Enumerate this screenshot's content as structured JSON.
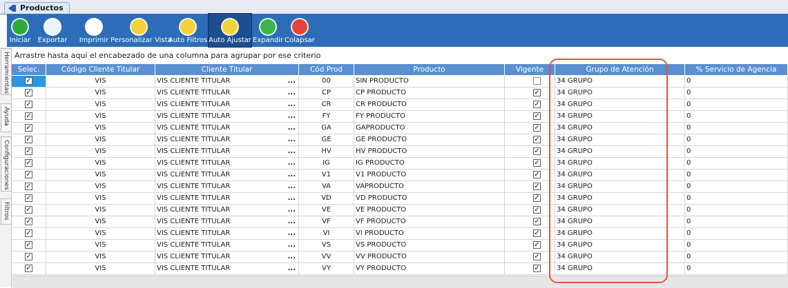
{
  "window_tab": {
    "label": "Productos"
  },
  "toolbar": [
    {
      "name": "iniciar-button",
      "label": "Iniciar",
      "icon": "play-icon",
      "color": "#2eaa3c"
    },
    {
      "name": "exportar-button",
      "label": "Exportar",
      "icon": "export-doc-icon",
      "color": "#e9f4ff"
    },
    {
      "name": "imprimir-button",
      "label": "Imprimir",
      "icon": "printer-icon",
      "color": "#ffffff"
    },
    {
      "name": "personalizar-vista-button",
      "label": "Personalizar Vista",
      "icon": "grid-view-icon",
      "color": "#f2d23a"
    },
    {
      "name": "auto-filtros-button",
      "label": "Auto Filtros",
      "icon": "filter-icon",
      "color": "#f2d23a"
    },
    {
      "name": "auto-ajustar-button",
      "label": "Auto Ajustar",
      "icon": "tools-icon",
      "color": "#f2d23a",
      "active": true
    },
    {
      "name": "expandir-button",
      "label": "Expandir",
      "icon": "expand-icon",
      "color": "#3ab54a"
    },
    {
      "name": "colapsar-button",
      "label": "Colapsar",
      "icon": "collapse-icon",
      "color": "#e2443a"
    }
  ],
  "side_tabs": [
    "Herramientas",
    "Ayuda",
    "Configuraciones",
    "Filtros"
  ],
  "group_hint": "Arrastre hasta aquí el encabezado de una columna para agrupar por ese criterio",
  "columns": [
    "Selec.",
    "Código Cliente Titular",
    "Cliente Titular",
    "Cód Prod",
    "Producto",
    "Vigente",
    "Grupo de Atención",
    "% Servicio de Agencia"
  ],
  "rows": [
    {
      "selected": true,
      "code": "VIS",
      "client": "VIS CLIENTE TITULAR",
      "prod_code": "00",
      "product": "SIN PRODUCTO",
      "vigente": false,
      "grupo": "34 GRUPO",
      "servicio": "0"
    },
    {
      "selected": true,
      "code": "VIS",
      "client": "VIS CLIENTE TITULAR",
      "prod_code": "CP",
      "product": "CP PRODUCTO",
      "vigente": true,
      "grupo": "34 GRUPO",
      "servicio": "0"
    },
    {
      "selected": true,
      "code": "VIS",
      "client": "VIS CLIENTE TITULAR",
      "prod_code": "CR",
      "product": "CR PRODUCTO",
      "vigente": true,
      "grupo": "34 GRUPO",
      "servicio": "0"
    },
    {
      "selected": true,
      "code": "VIS",
      "client": "VIS CLIENTE TITULAR",
      "prod_code": "FY",
      "product": "FY PRODUCTO",
      "vigente": true,
      "grupo": "34 GRUPO",
      "servicio": "0"
    },
    {
      "selected": true,
      "code": "VIS",
      "client": "VIS CLIENTE TITULAR",
      "prod_code": "GA",
      "product": "GAPRODUCTO",
      "vigente": true,
      "grupo": "34 GRUPO",
      "servicio": "0"
    },
    {
      "selected": true,
      "code": "VIS",
      "client": "VIS CLIENTE TITULAR",
      "prod_code": "GE",
      "product": "GE PRODUCTO",
      "vigente": true,
      "grupo": "34 GRUPO",
      "servicio": "0"
    },
    {
      "selected": true,
      "code": "VIS",
      "client": "VIS CLIENTE TITULAR",
      "prod_code": "HV",
      "product": "HV PRODUCTO",
      "vigente": true,
      "grupo": "34 GRUPO",
      "servicio": "0"
    },
    {
      "selected": true,
      "code": "VIS",
      "client": "VIS CLIENTE TITULAR",
      "prod_code": "IG",
      "product": "IG PRODUCTO",
      "vigente": true,
      "grupo": "34 GRUPO",
      "servicio": "0"
    },
    {
      "selected": true,
      "code": "VIS",
      "client": "VIS CLIENTE TITULAR",
      "prod_code": "V1",
      "product": "V1 PRODUCTO",
      "vigente": true,
      "grupo": "34 GRUPO",
      "servicio": "0"
    },
    {
      "selected": true,
      "code": "VIS",
      "client": "VIS CLIENTE TITULAR",
      "prod_code": "VA",
      "product": "VAPRODUCTO",
      "vigente": true,
      "grupo": "34 GRUPO",
      "servicio": "0"
    },
    {
      "selected": true,
      "code": "VIS",
      "client": "VIS CLIENTE TITULAR",
      "prod_code": "VD",
      "product": "VD PRODUCTO",
      "vigente": true,
      "grupo": "34 GRUPO",
      "servicio": "0"
    },
    {
      "selected": true,
      "code": "VIS",
      "client": "VIS CLIENTE TITULAR",
      "prod_code": "VE",
      "product": "VE PRODUCTO",
      "vigente": true,
      "grupo": "34 GRUPO",
      "servicio": "0"
    },
    {
      "selected": true,
      "code": "VIS",
      "client": "VIS CLIENTE TITULAR",
      "prod_code": "VF",
      "product": "VF PRODUCTO",
      "vigente": true,
      "grupo": "34 GRUPO",
      "servicio": "0"
    },
    {
      "selected": true,
      "code": "VIS",
      "client": "VIS CLIENTE TITULAR",
      "prod_code": "VI",
      "product": "VI PRODUCTO",
      "vigente": true,
      "grupo": "34 GRUPO",
      "servicio": "0"
    },
    {
      "selected": true,
      "code": "VIS",
      "client": "VIS CLIENTE TITULAR",
      "prod_code": "VS",
      "product": "VS PRODUCTO",
      "vigente": true,
      "grupo": "34 GRUPO",
      "servicio": "0"
    },
    {
      "selected": true,
      "code": "VIS",
      "client": "VIS CLIENTE TITULAR",
      "prod_code": "VV",
      "product": "VV PRODUCTO",
      "vigente": true,
      "grupo": "34 GRUPO",
      "servicio": "0"
    },
    {
      "selected": true,
      "code": "VIS",
      "client": "VIS CLIENTE TITULAR",
      "prod_code": "VY",
      "product": "VY PRODUCTO",
      "vigente": true,
      "grupo": "34 GRUPO",
      "servicio": "0"
    }
  ],
  "colors": {
    "toolbar_bg": "#2d6db8",
    "header_bg": "#5a8fd0",
    "highlight": "#e2553a",
    "selection": "#2a97e6"
  }
}
